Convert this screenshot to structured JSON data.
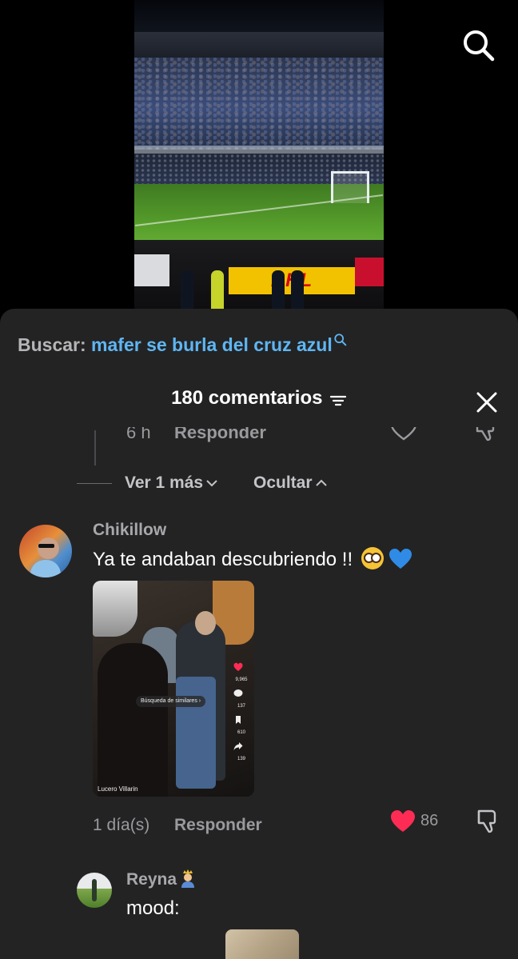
{
  "video": {
    "sponsor_text": "DHL"
  },
  "search_button": {
    "icon": "search-icon"
  },
  "sheet": {
    "search_prefix": "Buscar:",
    "search_query": "mafer se burla del cruz azul",
    "comments_count": "180 comentarios",
    "sort_icon": "sort-icon",
    "close_icon": "close-icon",
    "clipped_reply": {
      "time": "6 h",
      "reply_label": "Responder"
    },
    "replies_controls": {
      "view_more": "Ver 1 más",
      "hide": "Ocultar"
    }
  },
  "comments": [
    {
      "username": "Chikillow",
      "text": "Ya te andaban descubriendo !!",
      "emojis": [
        "flushed-face",
        "blue-heart"
      ],
      "video_thumbnail": {
        "chip_text": "Búsqueda de similares ›",
        "author": "Lucero Villarin",
        "likes": "9,965",
        "comments": "137",
        "saves": "610",
        "shares": "139"
      },
      "time": "1 día(s)",
      "reply_label": "Responder",
      "likes": "86",
      "liked": true
    },
    {
      "username": "Reyna",
      "username_emoji": "person-with-crown",
      "text": "mood:"
    }
  ],
  "colors": {
    "sheet_background": "#232324",
    "search_query": "#5fb6f2",
    "like_red": "#fe2c55",
    "muted_text": "#9a9a9e"
  }
}
